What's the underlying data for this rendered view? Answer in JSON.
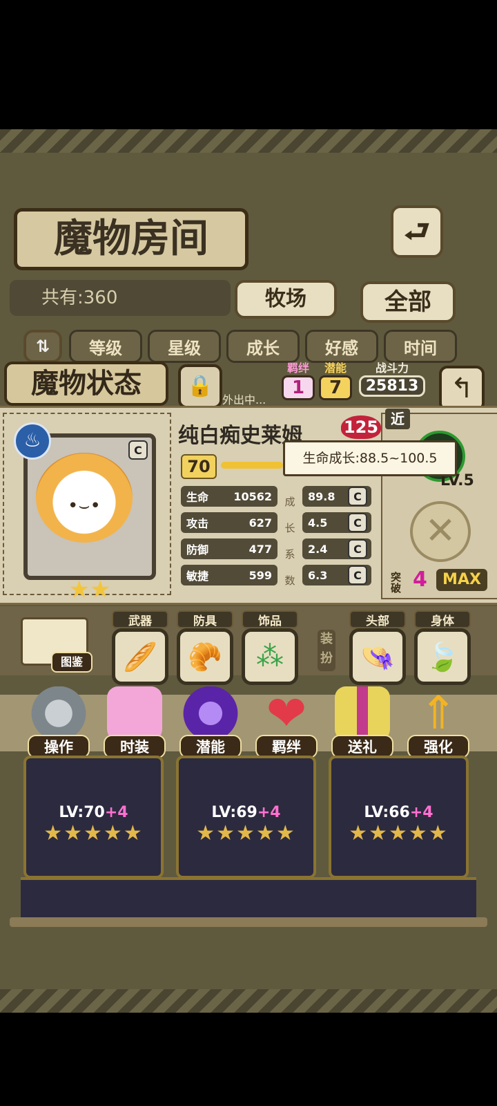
{
  "header": {
    "title": "魔物房间",
    "back_icon": "back-arrow-icon"
  },
  "filter": {
    "count": "共有:360",
    "tabs": [
      "牧场",
      "全部"
    ]
  },
  "sort_tabs": [
    "等级",
    "星级",
    "成长",
    "好感",
    "时间"
  ],
  "status": {
    "title": "魔物状态",
    "bond_label": "羁绊",
    "bond_value": "1",
    "potential_label": "潜能",
    "potential_value": "7",
    "power_label": "战斗力",
    "power_value": "25813",
    "away_text": "外出中...",
    "name": "纯白痴史莱姆",
    "name_badge": "125",
    "level": "70",
    "element_icon": "water-element-icon",
    "grade": "C",
    "star_count": 2,
    "tooltip": "生命成长:88.5~100.5",
    "range_tag": "近",
    "partner_level": "LV.5",
    "breakthrough_label": "突破",
    "breakthrough_value": "4",
    "max_label": "MAX",
    "growth_side_label": "成长系数",
    "stats": [
      {
        "label": "生命",
        "value": "10562",
        "growth": "89.8",
        "grade": "C"
      },
      {
        "label": "攻击",
        "value": "627",
        "growth": "4.5",
        "grade": "C"
      },
      {
        "label": "防御",
        "value": "477",
        "growth": "2.4",
        "grade": "C"
      },
      {
        "label": "敏捷",
        "value": "599",
        "growth": "6.3",
        "grade": "C"
      }
    ]
  },
  "equipment": {
    "book_label": "图鉴",
    "slots": [
      {
        "label": "武器",
        "icon": "bread-icon"
      },
      {
        "label": "防具",
        "icon": "bun-icon"
      },
      {
        "label": "饰品",
        "icon": "skewer-icon"
      }
    ],
    "dress_label": "装扮",
    "dress_slots": [
      {
        "label": "头部",
        "icon": "hat-icon"
      },
      {
        "label": "身体",
        "icon": "leaf-icon"
      }
    ]
  },
  "actions": [
    {
      "label": "操作",
      "icon": "gear-icon",
      "color": "#9aa3a8"
    },
    {
      "label": "时装",
      "icon": "clothing-icon",
      "color": "#f2a7d8"
    },
    {
      "label": "潜能",
      "icon": "potential-demon-icon",
      "color": "#7b3fd1"
    },
    {
      "label": "羁绊",
      "icon": "hearts-icon",
      "color": "#e23a48"
    },
    {
      "label": "送礼",
      "icon": "gift-icon",
      "color": "#e8d45a"
    },
    {
      "label": "强化",
      "icon": "upgrade-arrows-icon",
      "color": "#f3b323"
    }
  ],
  "cards": [
    {
      "level": "LV:70",
      "plus": "+4",
      "stars": "★★★★★"
    },
    {
      "level": "LV:69",
      "plus": "+4",
      "stars": "★★★★★"
    },
    {
      "level": "LV:66",
      "plus": "+4",
      "stars": "★★★★★"
    }
  ]
}
